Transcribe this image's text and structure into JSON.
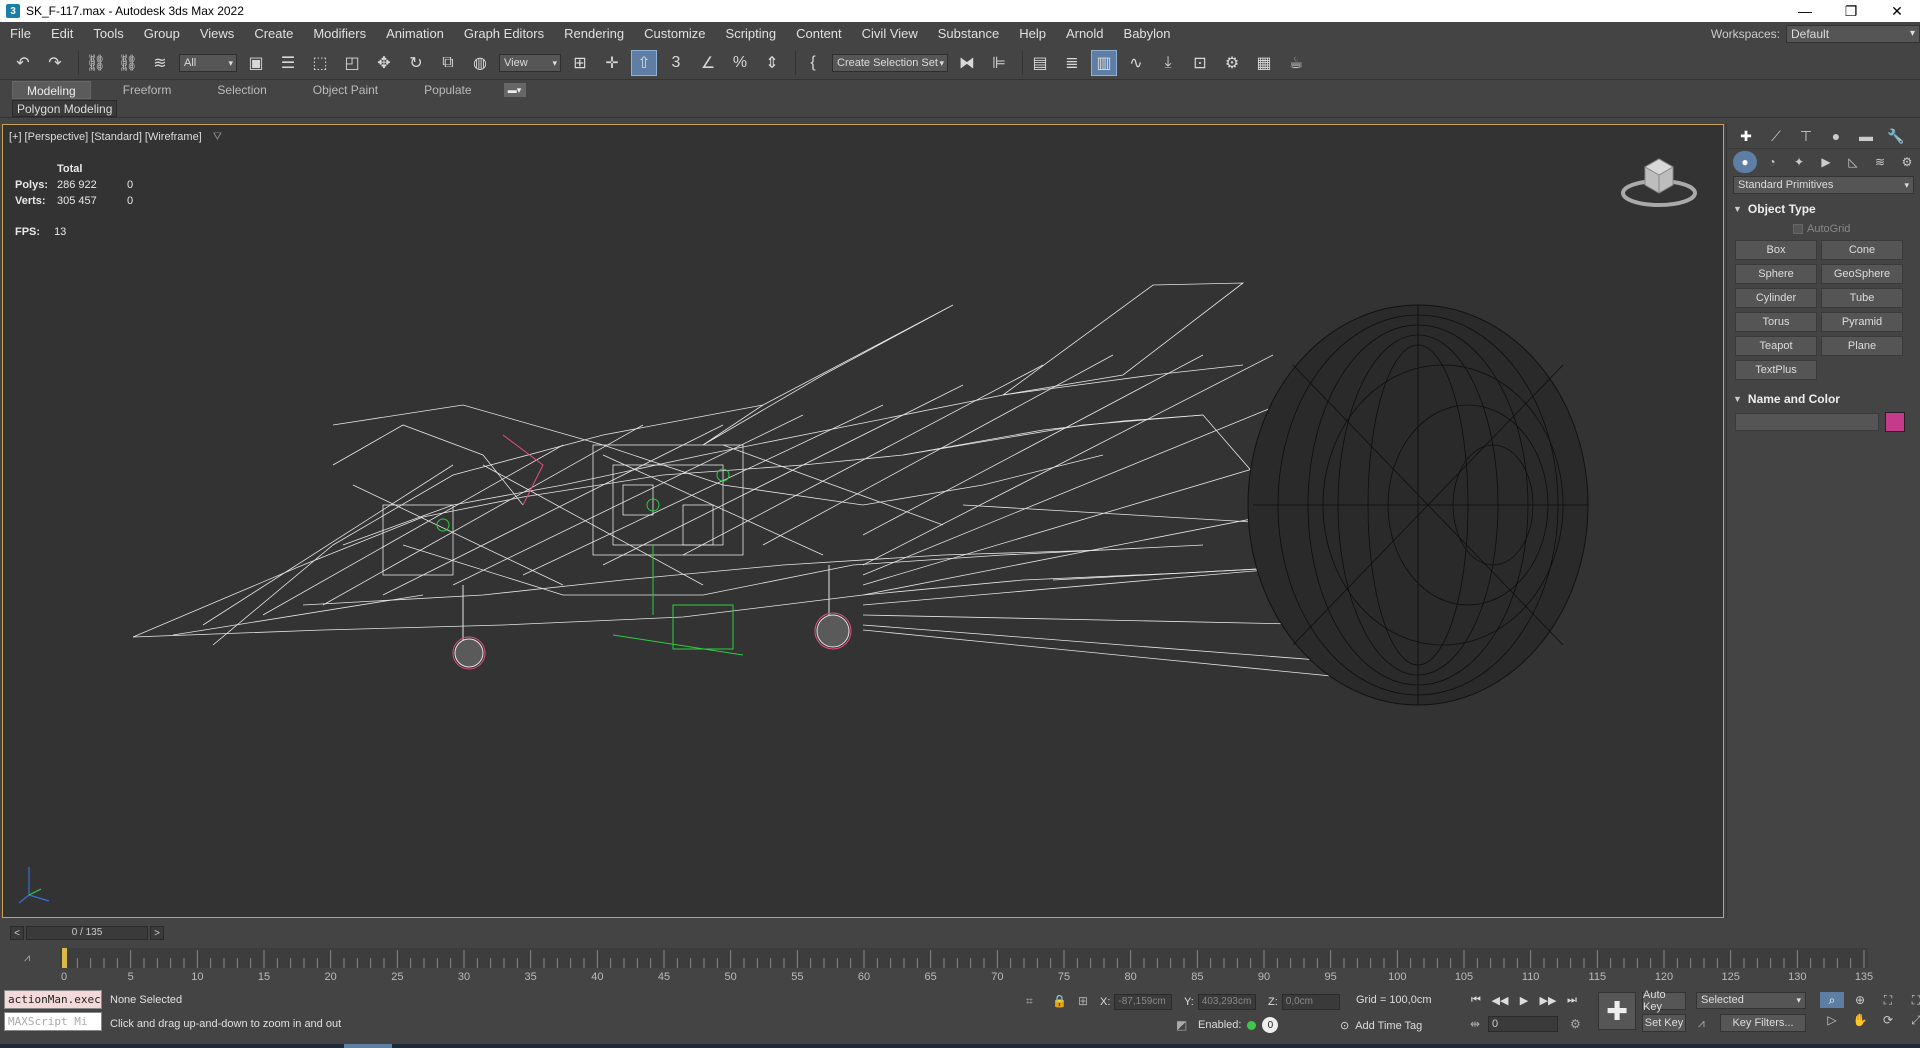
{
  "window": {
    "title": "SK_F-117.max - Autodesk 3ds Max 2022",
    "app_icon": "3",
    "controls": [
      "—",
      "❐",
      "✕"
    ]
  },
  "menu": {
    "items": [
      "File",
      "Edit",
      "Tools",
      "Group",
      "Views",
      "Create",
      "Modifiers",
      "Animation",
      "Graph Editors",
      "Rendering",
      "Customize",
      "Scripting",
      "Content",
      "Civil View",
      "Substance",
      "Help",
      "Arnold",
      "Babylon"
    ],
    "workspaces_label": "Workspaces:",
    "workspaces_value": "Default"
  },
  "toolbar": {
    "selection_filter": "All",
    "reference_coord": "View",
    "named_selection": "Create Selection Set"
  },
  "ribbon": {
    "tabs": [
      "Modeling",
      "Freeform",
      "Selection",
      "Object Paint",
      "Populate"
    ],
    "active_tab": "Modeling",
    "sub_label": "Polygon Modeling"
  },
  "viewport": {
    "labels": [
      "[+]",
      "[Perspective]",
      "[Standard]",
      "[Wireframe]"
    ],
    "stats": {
      "header": "Total",
      "polys_label": "Polys:",
      "polys_value": "286 922",
      "polys_sel": "0",
      "verts_label": "Verts:",
      "verts_value": "305 457",
      "verts_sel": "0"
    },
    "fps_label": "FPS:",
    "fps_value": "13"
  },
  "command_panel": {
    "tabs": [
      "create-icon",
      "modify-icon",
      "hierarchy-icon",
      "motion-icon",
      "display-icon",
      "utilities-icon"
    ],
    "category": "Standard Primitives",
    "object_type_title": "Object Type",
    "autogrid": "AutoGrid",
    "buttons": [
      "Box",
      "Cone",
      "Sphere",
      "GeoSphere",
      "Cylinder",
      "Tube",
      "Torus",
      "Pyramid",
      "Teapot",
      "Plane",
      "TextPlus"
    ],
    "name_color_title": "Name and Color",
    "color": "#c63a8c"
  },
  "timeline": {
    "frame": "0 / 135",
    "prev": "<",
    "next": ">",
    "ticks": [
      0,
      5,
      10,
      15,
      20,
      25,
      30,
      35,
      40,
      45,
      50,
      55,
      60,
      65,
      70,
      75,
      80,
      85,
      90,
      95,
      100,
      105,
      110,
      115,
      120,
      125,
      130,
      135
    ],
    "max": 135,
    "current": 0
  },
  "status": {
    "maxscript_1": "actionMan.execu",
    "maxscript_2": "MAXScript Mi",
    "selection": "None Selected",
    "prompt": "Click and drag up-and-down to zoom in and out",
    "x_label": "X:",
    "x_value": "-87,159cm",
    "y_label": "Y:",
    "y_value": "403,293cm",
    "z_label": "Z:",
    "z_value": "0,0cm",
    "grid": "Grid = 100,0cm",
    "enabled": "Enabled:",
    "enabled_count": "0",
    "add_time_tag": "Add Time Tag",
    "frame_field": "0",
    "auto_key": "Auto Key",
    "set_key": "Set Key",
    "key_mode": "Selected",
    "key_filters": "Key Filters..."
  }
}
